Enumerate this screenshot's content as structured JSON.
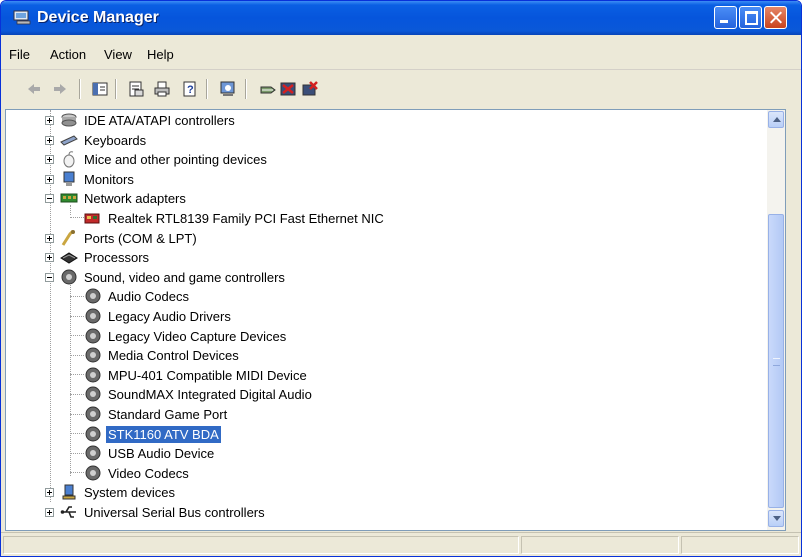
{
  "window": {
    "title": "Device Manager"
  },
  "menu": [
    "File",
    "Action",
    "View",
    "Help"
  ],
  "toolbar": {
    "icons": [
      "back-icon",
      "forward-icon",
      "console-tree-icon",
      "properties-icon",
      "print-icon",
      "help-icon",
      "scan-hardware-icon",
      "update-driver-icon",
      "disable-device-icon",
      "uninstall-device-icon"
    ]
  },
  "tree": {
    "items": [
      {
        "label": "IDE ATA/ATAPI controllers",
        "icon": "ide-controller-icon",
        "level": 0,
        "expander": "plus"
      },
      {
        "label": "Keyboards",
        "icon": "keyboard-icon",
        "level": 0,
        "expander": "plus"
      },
      {
        "label": "Mice and other pointing devices",
        "icon": "mouse-icon",
        "level": 0,
        "expander": "plus"
      },
      {
        "label": "Monitors",
        "icon": "monitor-icon",
        "level": 0,
        "expander": "plus"
      },
      {
        "label": "Network adapters",
        "icon": "network-adapter-icon",
        "level": 0,
        "expander": "minus"
      },
      {
        "label": "Realtek RTL8139 Family PCI Fast Ethernet NIC",
        "icon": "network-card-icon",
        "level": 1
      },
      {
        "label": "Ports (COM & LPT)",
        "icon": "port-icon",
        "level": 0,
        "expander": "plus"
      },
      {
        "label": "Processors",
        "icon": "processor-icon",
        "level": 0,
        "expander": "plus"
      },
      {
        "label": "Sound, video and game controllers",
        "icon": "speaker-icon",
        "level": 0,
        "expander": "minus"
      },
      {
        "label": "Audio Codecs",
        "icon": "speaker-icon",
        "level": 1
      },
      {
        "label": "Legacy Audio Drivers",
        "icon": "speaker-icon",
        "level": 1
      },
      {
        "label": "Legacy Video Capture Devices",
        "icon": "speaker-icon",
        "level": 1
      },
      {
        "label": "Media Control Devices",
        "icon": "speaker-icon",
        "level": 1
      },
      {
        "label": "MPU-401 Compatible MIDI Device",
        "icon": "speaker-icon",
        "level": 1
      },
      {
        "label": "SoundMAX Integrated Digital Audio",
        "icon": "speaker-icon",
        "level": 1
      },
      {
        "label": "Standard Game Port",
        "icon": "speaker-icon",
        "level": 1
      },
      {
        "label": "STK1160 ATV BDA",
        "icon": "speaker-icon",
        "level": 1,
        "selected": true
      },
      {
        "label": "USB Audio Device",
        "icon": "speaker-icon",
        "level": 1
      },
      {
        "label": "Video Codecs",
        "icon": "speaker-icon",
        "level": 1
      },
      {
        "label": "System devices",
        "icon": "system-device-icon",
        "level": 0,
        "expander": "plus"
      },
      {
        "label": "Universal Serial Bus controllers",
        "icon": "usb-icon",
        "level": 0,
        "expander": "plus"
      }
    ]
  },
  "colors": {
    "titlebar": "#0a5fe3",
    "selection": "#316ac5",
    "chrome": "#ece9d8"
  }
}
